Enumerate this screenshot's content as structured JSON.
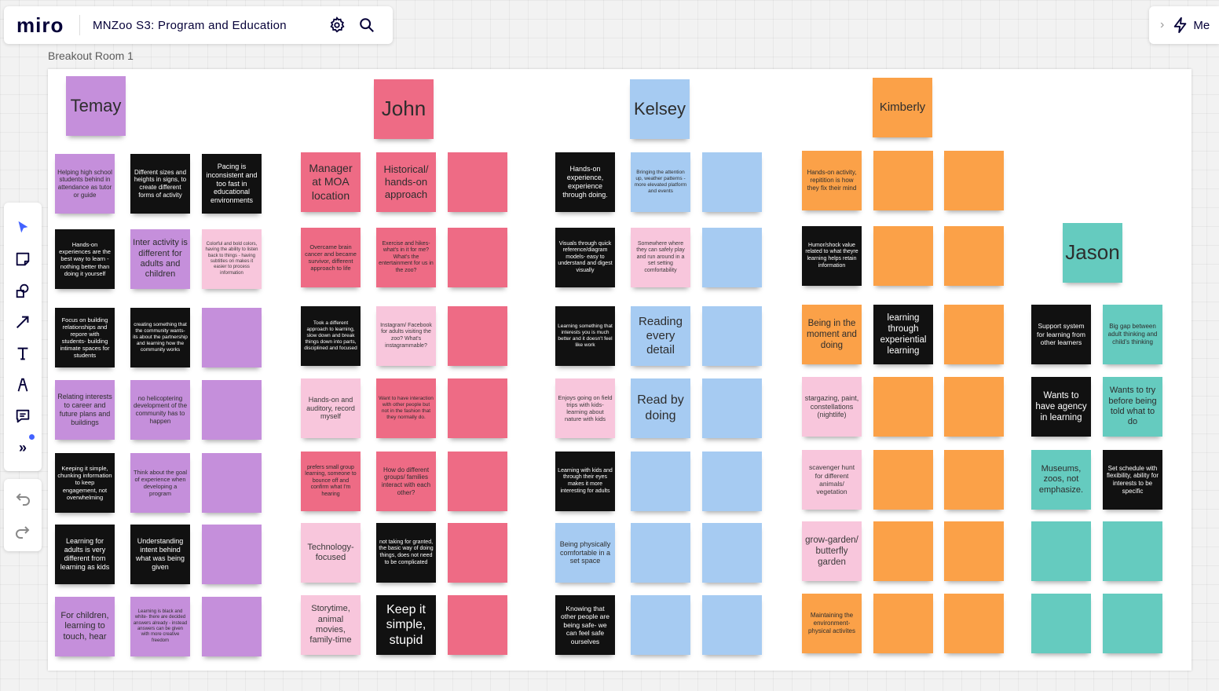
{
  "app": {
    "logo": "miro",
    "board_title": "MNZoo S3: Program and Education",
    "right_panel_label": "Me"
  },
  "icons": {
    "settings": "gear-icon",
    "search": "search-icon",
    "chevron": "chevron-right-icon",
    "bolt": "bolt-icon"
  },
  "toolbar": {
    "tools": [
      "select-tool-icon",
      "sticky-note-icon",
      "shapes-icon",
      "line-arrow-icon",
      "text-icon",
      "pen-icon",
      "comment-icon",
      "more-tools-icon"
    ],
    "undo": "undo-icon",
    "redo": "redo-icon"
  },
  "frame": {
    "label": "Breakout Room 1"
  },
  "colors": {
    "purple": "#c58fdb",
    "pink": "#f8c6dc",
    "red": "#ee6b85",
    "blue": "#a6cbf2",
    "orange": "#fba148",
    "teal": "#65cbbf",
    "black": "#111111",
    "accent": "#4262ff"
  },
  "headers": {
    "temay": "Temay",
    "john": "John",
    "kelsey": "Kelsey",
    "kimberly": "Kimberly",
    "jason": "Jason"
  },
  "temay": {
    "r1c1": "Helping high school students behind in attendance as tutor or guide",
    "r1c2": "Different sizes and heights in signs, to create different forms of activity",
    "r1c3": "Pacing is inconsistent and too fast in educational environments",
    "r2c1": "Hands-on experiences are the best way to learn - nothing better than doing it yourself",
    "r2c2": "Inter activity is different for adults and children",
    "r2c3": "Colorful and bold colors, having the ability to listen back to things - having subtitles on makes it easier to process information",
    "r3c1": "Focus on building relationships and repore with students- building intimate spaces for students",
    "r3c2": "creating something that the community wants- its about the partnership and learning how the community works",
    "r4c1": "Relating interests to career and future plans and buildings",
    "r4c2": "no helicoptering development of the community has to happen",
    "r5c1": "Keeping it simple, chunking information to keep engagement, not overwhelming",
    "r5c2": "Think about the goal of experience when developing a program",
    "r6c1": "Learning for adults is very different from learning as kids",
    "r6c2": "Understanding intent behind what was being given",
    "r7c1": "For children, learning to touch, hear",
    "r7c2": "Learning is black and white- there are decided answers already - instead answers can be given with more creative freedom"
  },
  "john": {
    "r1c1": "Manager at MOA location",
    "r1c2": "Historical/ hands-on approach",
    "r2c1": "Overcame brain cancer and became survivor, different approach to life",
    "r2c2": "Exercise and hikes- what's in it for me? What's the entertainment for us in the zoo?",
    "r3c1": "Took a different approach to learning, slow down and break things down into parts, disciplined and focused",
    "r3c2": "Instagram/ Facebook for adults visiting the zoo? What's instagrammable?",
    "r4c1": "Hands-on and auditory, record myself",
    "r4c2": "Want to have interaction with other people but not in the fashion that they normally do.",
    "r5c1": "prefers small group learning, someone to bounce off and confirm what I'm hearing",
    "r5c2": "How do different groups/ families interact with each other?",
    "r6c1": "Technology-focused",
    "r6c2": "not taking for granted, the basic way of doing things, does not need to be complicated",
    "r7c1": "Storytime, animal movies, family-time",
    "r7c2": "Keep it simple, stupid"
  },
  "kelsey": {
    "r1c1": "Hands-on experience, experience through doing.",
    "r1c2": "Bringing the attention up, weather patterns - more elevated platform and events",
    "r2c1": "Visuals through quick reference/diagram models- easy to understand and digest visually",
    "r2c2": "Somewhere where they can safely play and run around in a set setting comfortability",
    "r3c1": "Learning something that interests you is much better and it doesn't feel like work",
    "r3c2": "Reading every detail",
    "r4c1": "Enjoys going on field trips with kids- learning about nature with kids",
    "r4c2": "Read by doing",
    "r5c1": "Learning with kids and through their eyes makes it more interesting for adults",
    "r6c1": "Being physically comfortable in a set space",
    "r7c1": "Knowing that other people are being safe- we can feel safe ourselves"
  },
  "kimberly": {
    "r1c1": "Hands-on activity, repitition is how they fix their mind",
    "r2c1": "Humor/shock value related to what theyre learning helps retain information",
    "r3c1": "Being in the moment and doing",
    "r3c2": "learning through experiential learning",
    "r4c1": "stargazing, paint, constellations (nightlife)",
    "r5c1": "scavenger hunt for different animals/ vegetation",
    "r6c1": "grow-garden/ butterfly garden",
    "r7c1": "Maintaining the environment- physical activites"
  },
  "jason": {
    "r1c1": "Support system for learning from other learners",
    "r1c2": "Big gap between adult thinking and child's thinking",
    "r2c1": "Wants to have agency in learning",
    "r2c2": "Wants to try before being told what to do",
    "r3c1": "Museums, zoos, not emphasize.",
    "r3c2": "Set schedule with flexibility, ability for interests to be specific"
  }
}
